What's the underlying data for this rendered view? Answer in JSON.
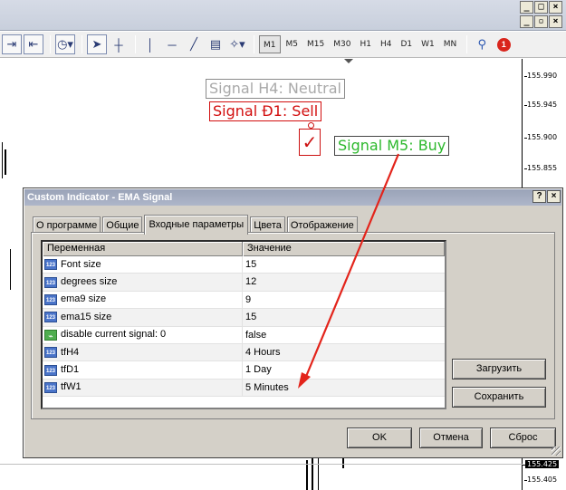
{
  "window": {
    "row1_controls": [
      {
        "label": "_",
        "name": "minimize"
      },
      {
        "label": "□",
        "name": "maximize"
      },
      {
        "label": "×",
        "name": "close"
      }
    ],
    "row2_controls": [
      {
        "label": "_",
        "name": "minimize"
      },
      {
        "label": "▫",
        "name": "restore"
      },
      {
        "label": "×",
        "name": "close"
      }
    ]
  },
  "toolbar": {
    "timeframes": [
      "M1",
      "M5",
      "M15",
      "M30",
      "H1",
      "H4",
      "D1",
      "W1",
      "MN"
    ],
    "active_timeframe": "M1",
    "alert_count": "1"
  },
  "chart": {
    "signals": {
      "h4": "Signal H4: Neutral",
      "d1": "Signal Ð1: Sell",
      "m5": "Signal M5: Buy"
    },
    "colors": {
      "neutral": "#a9a9a9",
      "sell": "#d20e0e",
      "buy": "#2cb82c",
      "arrow": "#e3241b"
    },
    "price_ticks": [
      "155.990",
      "155.945",
      "155.900",
      "155.855"
    ],
    "price_ticks_bottom": [
      "155.425",
      "155.405"
    ]
  },
  "dialog": {
    "title": "Custom Indicator - EMA Signal",
    "help_label": "?",
    "close_label": "×",
    "tabs": [
      "О программе",
      "Общие",
      "Входные параметры",
      "Цвета",
      "Отображение"
    ],
    "active_tab": "Входные параметры",
    "table": {
      "headers": [
        "Переменная",
        "Значение"
      ],
      "rows": [
        {
          "type": "123",
          "name": "Font size",
          "value": "15"
        },
        {
          "type": "123",
          "name": "degrees size",
          "value": "12"
        },
        {
          "type": "123",
          "name": "ema9 size",
          "value": "9"
        },
        {
          "type": "123",
          "name": "ema15 size",
          "value": "15"
        },
        {
          "type": "bool",
          "name": "disable current signal: 0",
          "value": "false"
        },
        {
          "type": "123",
          "name": "tfH4",
          "value": "4 Hours"
        },
        {
          "type": "123",
          "name": "tfD1",
          "value": "1 Day"
        },
        {
          "type": "123",
          "name": "tfW1",
          "value": "5 Minutes"
        }
      ]
    },
    "buttons": {
      "load": "Загрузить",
      "save": "Сохранить",
      "ok": "OK",
      "cancel": "Отмена",
      "reset": "Сброс"
    }
  }
}
